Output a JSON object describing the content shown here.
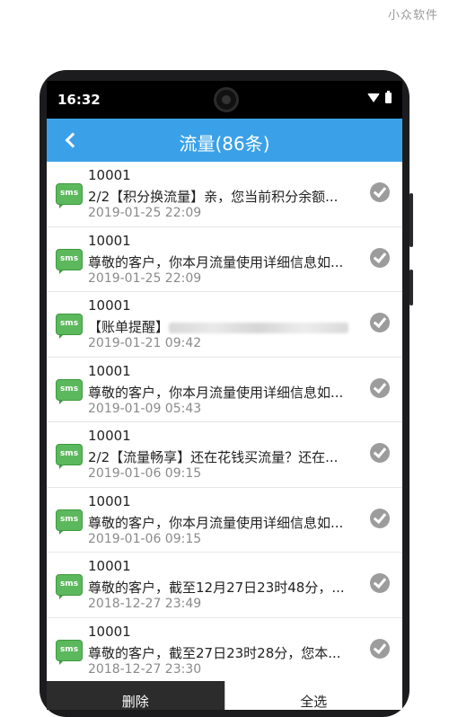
{
  "watermark": "小众软件",
  "status": {
    "time": "16:32"
  },
  "header": {
    "title": "流量(86条)"
  },
  "messages": [
    {
      "sender": "10001",
      "preview": "2/2【积分换流量】亲，您当前积分余额...",
      "date": "2019-01-25 22:09"
    },
    {
      "sender": "10001",
      "preview": "尊敬的客户，你本月流量使用详细信息如...",
      "date": "2019-01-25 22:09"
    },
    {
      "sender": "10001",
      "preview": "【账单提醒】",
      "date": "2019-01-21 09:42"
    },
    {
      "sender": "10001",
      "preview": "尊敬的客户，你本月流量使用详细信息如...",
      "date": "2019-01-09 05:43"
    },
    {
      "sender": "10001",
      "preview": "2/2【流量畅享】还在花钱买流量？还在...",
      "date": "2019-01-06 09:15"
    },
    {
      "sender": "10001",
      "preview": "尊敬的客户，你本月流量使用详细信息如...",
      "date": "2019-01-06 09:15"
    },
    {
      "sender": "10001",
      "preview": "尊敬的客户，截至12月27日23时48分，...",
      "date": "2018-12-27 23:49"
    },
    {
      "sender": "10001",
      "preview": "尊敬的客户，截至27日23时28分，您本...",
      "date": "2018-12-27 23:30"
    }
  ],
  "sms_label": "sms",
  "bottom": {
    "delete_label": "删除",
    "select_all_label": "全选"
  }
}
